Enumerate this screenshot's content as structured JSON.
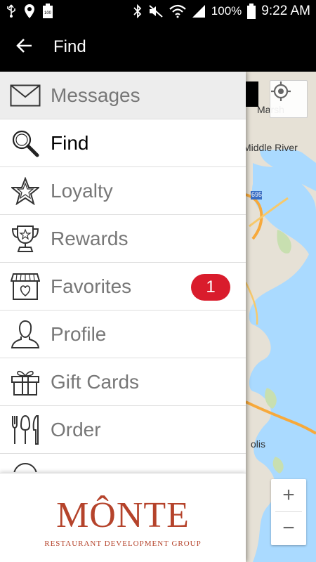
{
  "status_bar": {
    "battery_level_text": "100",
    "battery_percent": "100%",
    "time": "9:22 AM",
    "icons": [
      "usb-icon",
      "location-icon",
      "battery-small-icon",
      "bluetooth-icon",
      "mute-icon",
      "wifi-icon",
      "signal-icon",
      "battery-icon"
    ]
  },
  "app_bar": {
    "title": "Find",
    "back_icon": "arrow-left-icon"
  },
  "map": {
    "labels": [
      "Marsh",
      "Middle River",
      "695",
      "olis"
    ],
    "zoom_in": "+",
    "zoom_out": "−",
    "water_color": "#aadaff",
    "land_color": "#e6e1d6",
    "highway_color": "#f7a93b"
  },
  "drawer": {
    "items": [
      {
        "label": "Messages",
        "icon": "envelope-icon"
      },
      {
        "label": "Find",
        "icon": "magnifier-icon"
      },
      {
        "label": "Loyalty",
        "icon": "star-icon"
      },
      {
        "label": "Rewards",
        "icon": "trophy-icon"
      },
      {
        "label": "Favorites",
        "icon": "storefront-heart-icon",
        "badge": "1"
      },
      {
        "label": "Profile",
        "icon": "person-icon"
      },
      {
        "label": "Gift Cards",
        "icon": "gift-icon"
      },
      {
        "label": "Order",
        "icon": "utensils-icon"
      }
    ],
    "footer": {
      "logo_text": "MÔNTE",
      "logo_subtext": "RESTAURANT DEVELOPMENT GROUP",
      "brand_color": "#b5432b"
    }
  },
  "colors": {
    "badge": "#d91c2c",
    "app_bar": "#000000"
  }
}
